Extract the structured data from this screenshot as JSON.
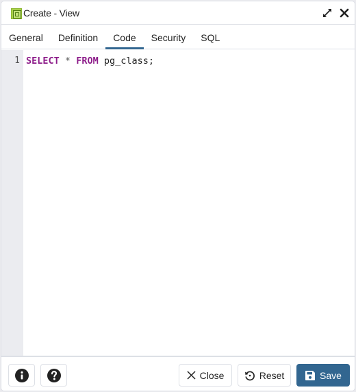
{
  "window": {
    "title": "Create - View",
    "icon": "view-icon",
    "actions": [
      {
        "name": "expand",
        "icon": "expand-icon"
      },
      {
        "name": "close",
        "icon": "close-icon"
      }
    ]
  },
  "tabs": [
    {
      "label": "General",
      "active": false
    },
    {
      "label": "Definition",
      "active": false
    },
    {
      "label": "Code",
      "active": true
    },
    {
      "label": "Security",
      "active": false
    },
    {
      "label": "SQL",
      "active": false
    }
  ],
  "editor": {
    "lines": [
      {
        "number": "1",
        "tokens": {
          "kw1": "SELECT",
          "op": "*",
          "kw2": "FROM",
          "ident": "pg_class;"
        }
      }
    ]
  },
  "footer": {
    "info_icon": "info-circle-icon",
    "help_icon": "question-circle-icon",
    "close_label": "Close",
    "reset_label": "Reset",
    "save_label": "Save"
  },
  "colors": {
    "accent": "#326690",
    "keyword": "#8d1d8a",
    "gutter": "#ebecf0"
  }
}
